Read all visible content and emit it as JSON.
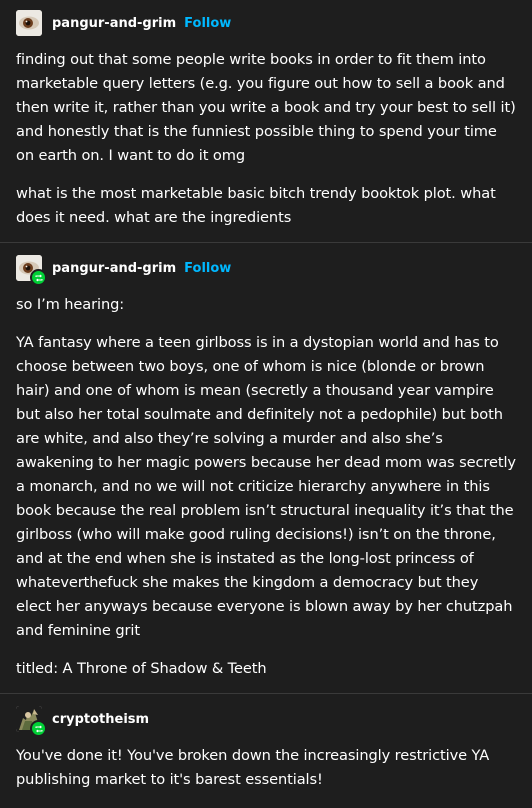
{
  "posts": [
    {
      "username": "pangur-and-grim",
      "follow_label": "Follow",
      "avatar_icon": "eye-avatar-icon",
      "reblogged": false,
      "paragraphs": [
        "finding out that some people write books in order to fit them into marketable query letters (e.g. you figure out how to sell a book and then write it, rather than you write a book and try your best to sell it) and honestly that is the funniest possible thing to spend your time on earth on. I want to do it omg",
        "what is the most marketable basic bitch trendy booktok plot. what does it need. what are the ingredients"
      ]
    },
    {
      "username": "pangur-and-grim",
      "follow_label": "Follow",
      "avatar_icon": "eye-avatar-icon",
      "reblogged": true,
      "paragraphs": [
        "so I’m hearing:",
        "YA fantasy where a teen girlboss is in a dystopian world and has to choose between two boys, one of whom is nice (blonde or brown hair) and one of whom is mean (secretly a thousand year vampire but also her total soulmate and definitely not a pedophile) but both are white, and also they’re solving a murder and also she’s awakening to her magic powers because her dead mom was secretly a monarch, and no we will not criticize hierarchy anywhere in this book because the real problem isn’t structural inequality it’s that the girlboss (who will make good ruling decisions!) isn’t on the throne, and at the end when she is instated as the long-lost princess of whateverthefuck she makes the kingdom a democracy but they elect her anyways because everyone is blown away by her chutzpah and feminine grit",
        "titled: A Throne of Shadow & Teeth"
      ]
    },
    {
      "username": "cryptotheism",
      "avatar_icon": "figure-avatar-icon",
      "reblogged": true,
      "paragraphs": [
        "You've done it! You've broken down the increasingly restrictive YA publishing market to it's barest essentials!"
      ]
    }
  ],
  "colors": {
    "background": "#1e1e1e",
    "text": "#ffffff",
    "follow": "#00b8ff",
    "reblog_badge": "#00cf35",
    "divider": "#3a3a3a"
  }
}
